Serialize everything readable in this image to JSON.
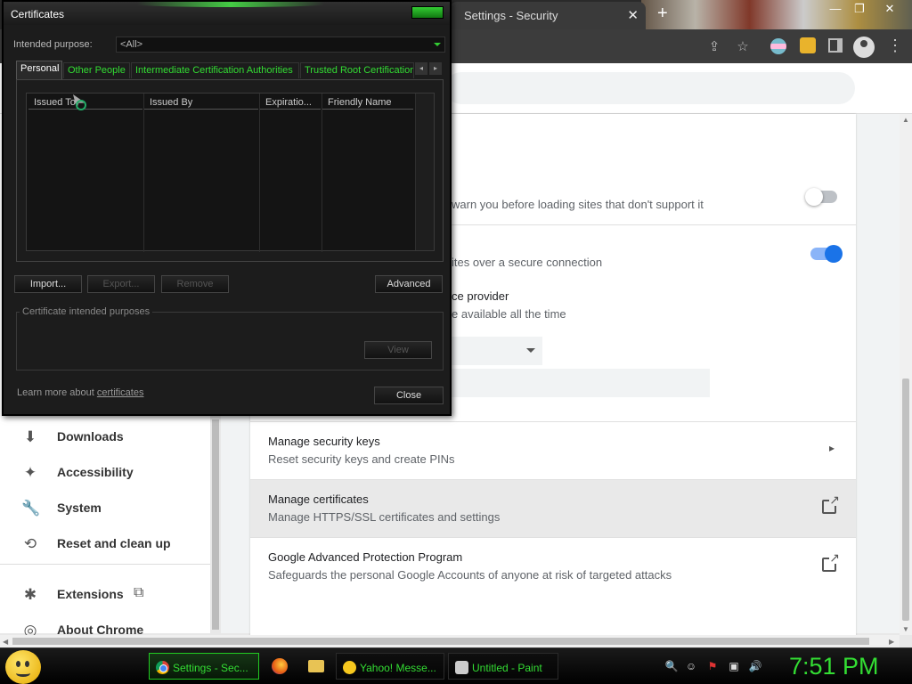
{
  "browser": {
    "tab_title": "Settings - Security",
    "tab_close": "✕",
    "new_tab": "+",
    "window_controls": {
      "minimize": "—",
      "maximize": "❐",
      "close": "✕"
    }
  },
  "settings_nav": {
    "items": [
      {
        "label": "Downloads",
        "icon": "⬇"
      },
      {
        "label": "Accessibility",
        "icon": "✦"
      },
      {
        "label": "System",
        "icon": "🔧"
      },
      {
        "label": "Reset and clean up",
        "icon": "⟲"
      },
      {
        "label": "Extensions",
        "icon": "✱"
      },
      {
        "label": "About Chrome",
        "icon": "◎"
      }
    ],
    "extensions_external_icon": "⧉"
  },
  "security_page": {
    "partial_texts": {
      "https_warn": "warn you before loading sites that don't support it",
      "secure_dns": "ites over a secure connection",
      "service_provider": "ce provider",
      "available": "e available all the time"
    },
    "toggles": {
      "https_first": false,
      "secure_dns": true
    },
    "rows": [
      {
        "title": "Manage security keys",
        "subtitle": "Reset security keys and create PINs",
        "action": "arrow"
      },
      {
        "title": "Manage certificates",
        "subtitle": "Manage HTTPS/SSL certificates and settings",
        "action": "external",
        "highlighted": true
      },
      {
        "title": "Google Advanced Protection Program",
        "subtitle": "Safeguards the personal Google Accounts of anyone at risk of targeted attacks",
        "action": "external"
      }
    ],
    "row_arrow": "▸"
  },
  "certificates_dialog": {
    "title": "Certificates",
    "intended_purpose_label": "Intended purpose:",
    "intended_purpose_value": "<All>",
    "tabs": [
      "Personal",
      "Other People",
      "Intermediate Certification Authorities",
      "Trusted Root Certification"
    ],
    "tab_scroll": {
      "left": "◂",
      "right": "▸"
    },
    "columns": [
      "Issued To",
      "Issued By",
      "Expiratio...",
      "Friendly Name"
    ],
    "buttons": {
      "import": "Import...",
      "export": "Export...",
      "remove": "Remove",
      "advanced": "Advanced",
      "view": "View",
      "close": "Close"
    },
    "purposes_group_label": "Certificate intended purposes",
    "learn_more_text": "Learn more about ",
    "learn_more_link": "certificates"
  },
  "taskbar": {
    "tasks": [
      {
        "label": "Settings - Sec...",
        "active": true,
        "icon": "chrome-icon"
      },
      {
        "label": "Yahoo! Messe...",
        "active": false,
        "icon": "yahoo-messenger-icon"
      },
      {
        "label": "Untitled - Paint",
        "active": false,
        "icon": "paint-icon"
      }
    ],
    "tray_icons": [
      "🔍",
      "☺",
      "⚑",
      "▣",
      "🔊"
    ],
    "clock": "7:51 PM"
  },
  "colors": {
    "accent_green": "#33dd33",
    "chrome_blue": "#1a73e8",
    "dialog_bg": "#1c1c1c"
  }
}
